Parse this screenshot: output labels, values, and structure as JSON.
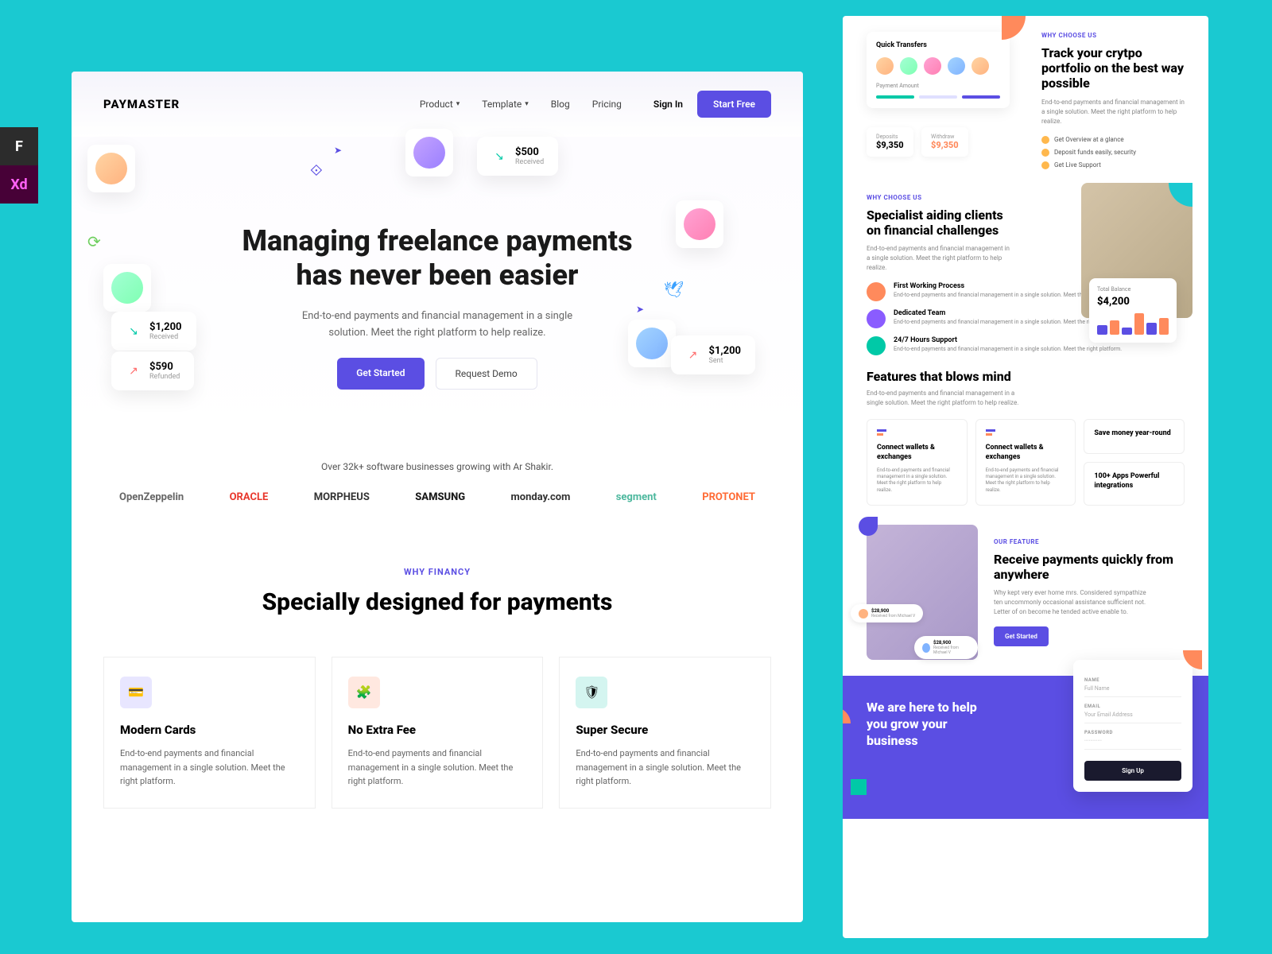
{
  "badges": {
    "figma": "F",
    "xd": "Xd"
  },
  "nav": {
    "logo": "PAYMASTER",
    "links": [
      "Product",
      "Template",
      "Blog",
      "Pricing"
    ],
    "signin": "Sign In",
    "cta": "Start Free"
  },
  "hero": {
    "headline1": "Managing freelance payments",
    "headline2": "has never been easier",
    "sub": "End-to-end payments and financial management in a single solution. Meet the right platform to help realize.",
    "btn1": "Get Started",
    "btn2": "Request Demo",
    "t1": {
      "amt": "$500",
      "lbl": "Received"
    },
    "t2": {
      "amt": "$1,200",
      "lbl": "Received"
    },
    "t3": {
      "amt": "$590",
      "lbl": "Refunded"
    },
    "t4": {
      "amt": "$1,200",
      "lbl": "Sent"
    }
  },
  "trust": {
    "txt": "Over 32k+ software businesses growing with Ar Shakir.",
    "logos": [
      "OpenZeppelin",
      "ORACLE",
      "MORPHEUS",
      "SAMSUNG",
      "monday.com",
      "segment",
      "PROTONET"
    ]
  },
  "why": {
    "eyebrow": "WHY FINANCY",
    "h": "Specially designed for payments",
    "cards": [
      {
        "t": "Modern Cards",
        "d": "End-to-end payments and financial management in a single solution. Meet the right platform."
      },
      {
        "t": "No Extra Fee",
        "d": "End-to-end payments and financial management in a single solution. Meet the right platform."
      },
      {
        "t": "Super Secure",
        "d": "End-to-end payments and financial management in a single solution. Meet the right platform."
      }
    ]
  },
  "s1": {
    "ey": "WHY CHOOSE US",
    "h": "Track your crytpo portfolio on the best way possible",
    "sb": "End-to-end payments and financial management in a single solution. Meet the right platform to help realize.",
    "b": [
      "Get Overview at a glance",
      "Deposit funds easily, security",
      "Get Live Support"
    ],
    "qt": "Quick Transfers",
    "pa": "Payment Amount",
    "st1l": "Deposits",
    "st1v": "$9,350",
    "st2l": "Withdraw",
    "st2v": "$9,350"
  },
  "s2": {
    "ey": "WHY CHOOSE US",
    "h": "Specialist aiding clients on financial challenges",
    "sb": "End-to-end payments and financial management in a single solution. Meet the right platform to help realize.",
    "f": [
      {
        "t": "First Working Process",
        "d": "End-to-end payments and financial management in a single solution. Meet the right platform."
      },
      {
        "t": "Dedicated Team",
        "d": "End-to-end payments and financial management in a single solution. Meet the right platform."
      },
      {
        "t": "24/7 Hours Support",
        "d": "End-to-end payments and financial management in a single solution. Meet the right platform."
      }
    ],
    "tbl": "Total Balance",
    "tbv": "$4,200"
  },
  "s3": {
    "h": "Features that blows mind",
    "sb": "End-to-end payments and financial management in a single solution. Meet the right platform to help realize.",
    "boxes": [
      {
        "t": "Connect wallets & exchanges",
        "d": "End-to-end payments and financial management in a single solution. Meet the right platform to help realize."
      },
      {
        "t": "Connect wallets & exchanges",
        "d": "End-to-end payments and financial management in a single solution. Meet the right platform to help realize."
      },
      {
        "t": "Save money year-round",
        "d": ""
      },
      {
        "t": "100+ Apps Powerful integrations",
        "d": ""
      }
    ]
  },
  "s4": {
    "ey": "OUR FEATURE",
    "h": "Receive payments quickly from anywhere",
    "sb": "Why kept very ever home mrs. Considered sympathize ten uncommonly occasional assistance sufficient not. Letter of on become he tended active enable to.",
    "btn": "Get Started",
    "p1": "$28,900",
    "p1s": "Received from Michael V",
    "p2": "$28,900",
    "p2s": "Received from Michael V"
  },
  "s5": {
    "h": "We are here to help you grow your business",
    "fn": "NAME",
    "fnp": "Full Name",
    "fe": "EMAIL",
    "fep": "Your Email Address",
    "fp": "PASSWORD",
    "fpp": "············",
    "fb": "Sign Up"
  }
}
